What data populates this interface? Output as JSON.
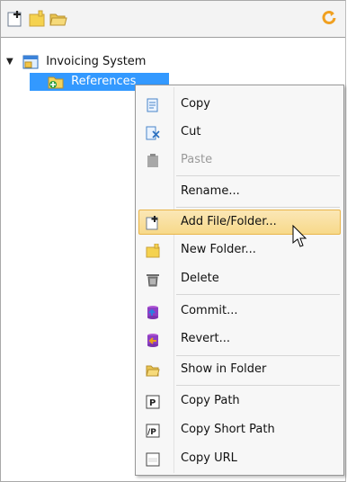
{
  "tree": {
    "root_label": "Invoicing System",
    "child_label": "References"
  },
  "menu": {
    "items": [
      {
        "label": "Copy",
        "icon": "copy-icon",
        "enabled": true
      },
      {
        "label": "Cut",
        "icon": "cut-icon",
        "enabled": true
      },
      {
        "label": "Paste",
        "icon": "paste-icon",
        "enabled": false
      },
      {
        "label": "Rename...",
        "icon": "none",
        "enabled": true
      },
      {
        "label": "Add File/Folder...",
        "icon": "add-file-icon",
        "enabled": true,
        "highlighted": true
      },
      {
        "label": "New Folder...",
        "icon": "new-folder-icon",
        "enabled": true
      },
      {
        "label": "Delete",
        "icon": "trash-icon",
        "enabled": true
      },
      {
        "label": "Commit...",
        "icon": "commit-icon",
        "enabled": true
      },
      {
        "label": "Revert...",
        "icon": "revert-icon",
        "enabled": true
      },
      {
        "label": "Show in Folder",
        "icon": "folder-open-icon",
        "enabled": true
      },
      {
        "label": "Copy Path",
        "icon": "copy-path-icon",
        "enabled": true
      },
      {
        "label": "Copy Short Path",
        "icon": "copy-short-path-icon",
        "enabled": true
      },
      {
        "label": "Copy URL",
        "icon": "copy-url-icon",
        "enabled": true
      }
    ]
  },
  "colors": {
    "selection": "#3399ff",
    "hover_fill": "#f8dd95",
    "hover_border": "#e9b54a"
  }
}
